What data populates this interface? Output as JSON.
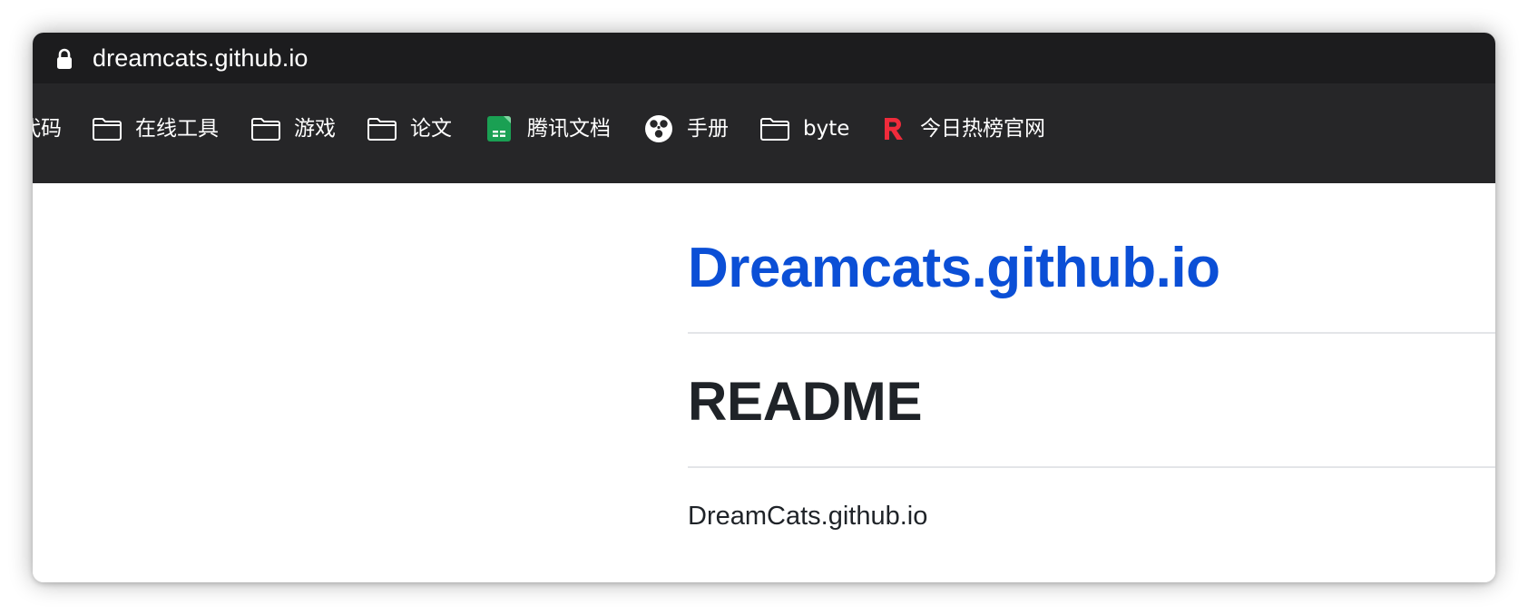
{
  "browser": {
    "url": "dreamcats.github.io",
    "lock_icon": "lock-icon"
  },
  "bookmarks": [
    {
      "label": "代码",
      "icon": "none"
    },
    {
      "label": "在线工具",
      "icon": "folder-icon"
    },
    {
      "label": "游戏",
      "icon": "folder-icon"
    },
    {
      "label": "论文",
      "icon": "folder-icon"
    },
    {
      "label": "腾讯文档",
      "icon": "tencent-docs-icon"
    },
    {
      "label": "手册",
      "icon": "handbook-icon"
    },
    {
      "label": "byte",
      "icon": "folder-icon"
    },
    {
      "label": "今日热榜官网",
      "icon": "rebang-logo-icon"
    }
  ],
  "page": {
    "site_title": "Dreamcats.github.io",
    "heading": "README",
    "paragraph": "DreamCats.github.io"
  },
  "colors": {
    "chrome_dark": "#1c1c1e",
    "bookmarks_bar": "#262628",
    "link_blue": "#0b4fd6",
    "heading_text": "#1f2328",
    "divider": "#e3e5e8",
    "tencent_green": "#1aa053",
    "rebang_red": "#ef2b3b"
  }
}
